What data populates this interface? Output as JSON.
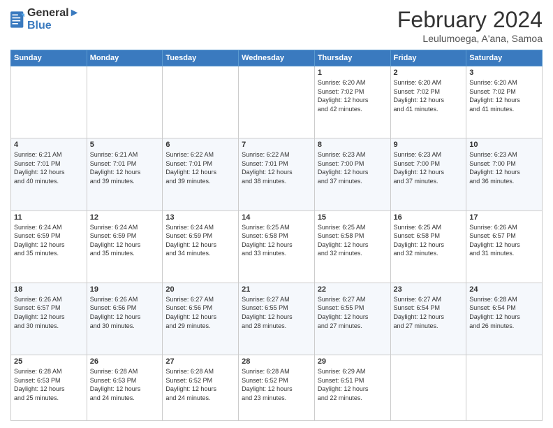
{
  "logo": {
    "line1": "General",
    "line2": "Blue"
  },
  "title": "February 2024",
  "subtitle": "Leulumoega, A'ana, Samoa",
  "days_of_week": [
    "Sunday",
    "Monday",
    "Tuesday",
    "Wednesday",
    "Thursday",
    "Friday",
    "Saturday"
  ],
  "weeks": [
    [
      {
        "day": "",
        "content": ""
      },
      {
        "day": "",
        "content": ""
      },
      {
        "day": "",
        "content": ""
      },
      {
        "day": "",
        "content": ""
      },
      {
        "day": "1",
        "content": "Sunrise: 6:20 AM\nSunset: 7:02 PM\nDaylight: 12 hours\nand 42 minutes."
      },
      {
        "day": "2",
        "content": "Sunrise: 6:20 AM\nSunset: 7:02 PM\nDaylight: 12 hours\nand 41 minutes."
      },
      {
        "day": "3",
        "content": "Sunrise: 6:20 AM\nSunset: 7:02 PM\nDaylight: 12 hours\nand 41 minutes."
      }
    ],
    [
      {
        "day": "4",
        "content": "Sunrise: 6:21 AM\nSunset: 7:01 PM\nDaylight: 12 hours\nand 40 minutes."
      },
      {
        "day": "5",
        "content": "Sunrise: 6:21 AM\nSunset: 7:01 PM\nDaylight: 12 hours\nand 39 minutes."
      },
      {
        "day": "6",
        "content": "Sunrise: 6:22 AM\nSunset: 7:01 PM\nDaylight: 12 hours\nand 39 minutes."
      },
      {
        "day": "7",
        "content": "Sunrise: 6:22 AM\nSunset: 7:01 PM\nDaylight: 12 hours\nand 38 minutes."
      },
      {
        "day": "8",
        "content": "Sunrise: 6:23 AM\nSunset: 7:00 PM\nDaylight: 12 hours\nand 37 minutes."
      },
      {
        "day": "9",
        "content": "Sunrise: 6:23 AM\nSunset: 7:00 PM\nDaylight: 12 hours\nand 37 minutes."
      },
      {
        "day": "10",
        "content": "Sunrise: 6:23 AM\nSunset: 7:00 PM\nDaylight: 12 hours\nand 36 minutes."
      }
    ],
    [
      {
        "day": "11",
        "content": "Sunrise: 6:24 AM\nSunset: 6:59 PM\nDaylight: 12 hours\nand 35 minutes."
      },
      {
        "day": "12",
        "content": "Sunrise: 6:24 AM\nSunset: 6:59 PM\nDaylight: 12 hours\nand 35 minutes."
      },
      {
        "day": "13",
        "content": "Sunrise: 6:24 AM\nSunset: 6:59 PM\nDaylight: 12 hours\nand 34 minutes."
      },
      {
        "day": "14",
        "content": "Sunrise: 6:25 AM\nSunset: 6:58 PM\nDaylight: 12 hours\nand 33 minutes."
      },
      {
        "day": "15",
        "content": "Sunrise: 6:25 AM\nSunset: 6:58 PM\nDaylight: 12 hours\nand 32 minutes."
      },
      {
        "day": "16",
        "content": "Sunrise: 6:25 AM\nSunset: 6:58 PM\nDaylight: 12 hours\nand 32 minutes."
      },
      {
        "day": "17",
        "content": "Sunrise: 6:26 AM\nSunset: 6:57 PM\nDaylight: 12 hours\nand 31 minutes."
      }
    ],
    [
      {
        "day": "18",
        "content": "Sunrise: 6:26 AM\nSunset: 6:57 PM\nDaylight: 12 hours\nand 30 minutes."
      },
      {
        "day": "19",
        "content": "Sunrise: 6:26 AM\nSunset: 6:56 PM\nDaylight: 12 hours\nand 30 minutes."
      },
      {
        "day": "20",
        "content": "Sunrise: 6:27 AM\nSunset: 6:56 PM\nDaylight: 12 hours\nand 29 minutes."
      },
      {
        "day": "21",
        "content": "Sunrise: 6:27 AM\nSunset: 6:55 PM\nDaylight: 12 hours\nand 28 minutes."
      },
      {
        "day": "22",
        "content": "Sunrise: 6:27 AM\nSunset: 6:55 PM\nDaylight: 12 hours\nand 27 minutes."
      },
      {
        "day": "23",
        "content": "Sunrise: 6:27 AM\nSunset: 6:54 PM\nDaylight: 12 hours\nand 27 minutes."
      },
      {
        "day": "24",
        "content": "Sunrise: 6:28 AM\nSunset: 6:54 PM\nDaylight: 12 hours\nand 26 minutes."
      }
    ],
    [
      {
        "day": "25",
        "content": "Sunrise: 6:28 AM\nSunset: 6:53 PM\nDaylight: 12 hours\nand 25 minutes."
      },
      {
        "day": "26",
        "content": "Sunrise: 6:28 AM\nSunset: 6:53 PM\nDaylight: 12 hours\nand 24 minutes."
      },
      {
        "day": "27",
        "content": "Sunrise: 6:28 AM\nSunset: 6:52 PM\nDaylight: 12 hours\nand 24 minutes."
      },
      {
        "day": "28",
        "content": "Sunrise: 6:28 AM\nSunset: 6:52 PM\nDaylight: 12 hours\nand 23 minutes."
      },
      {
        "day": "29",
        "content": "Sunrise: 6:29 AM\nSunset: 6:51 PM\nDaylight: 12 hours\nand 22 minutes."
      },
      {
        "day": "",
        "content": ""
      },
      {
        "day": "",
        "content": ""
      }
    ]
  ]
}
